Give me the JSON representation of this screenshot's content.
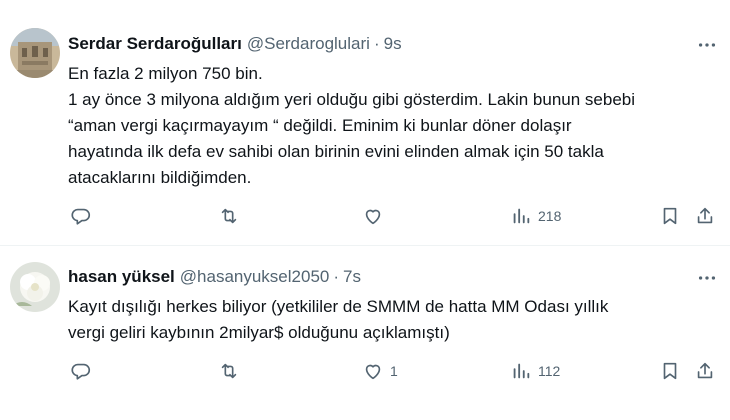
{
  "tweets": [
    {
      "name": "Serdar Serdaroğulları",
      "handle": "@Serdaroglulari",
      "separator": "·",
      "time": "9s",
      "lines": [
        "En fazla 2 milyon 750 bin.",
        "1 ay önce 3 milyona aldığım yeri olduğu gibi gösterdim. Lakin bunun sebebi",
        "“aman vergi kaçırmayayım “ değildi. Eminim ki bunlar döner dolaşır",
        "hayatında ilk defa ev sahibi olan birinin evini elinden almak için 50 takla",
        "atacaklarını bildiğimden."
      ],
      "actions": {
        "reply_count": "",
        "retweet_count": "",
        "like_count": "",
        "views_count": "218"
      }
    },
    {
      "name": "hasan yüksel",
      "handle": "@hasanyuksel2050",
      "separator": "·",
      "time": "7s",
      "lines": [
        "Kayıt dışılığı herkes biliyor (yetkililer de SMMM de hatta MM Odası yıllık",
        "vergi geliri kaybının 2milyar$ olduğunu açıklamıştı)"
      ],
      "actions": {
        "reply_count": "",
        "retweet_count": "",
        "like_count": "1",
        "views_count": "112"
      }
    }
  ],
  "icons": {
    "more": "more-dots-icon",
    "reply": "reply-icon",
    "retweet": "retweet-icon",
    "like": "heart-icon",
    "views": "views-chart-icon",
    "bookmark": "bookmark-icon",
    "share": "share-icon"
  },
  "colors": {
    "text": "#0f1419",
    "secondary": "#536471",
    "divider": "#eff3f4"
  }
}
